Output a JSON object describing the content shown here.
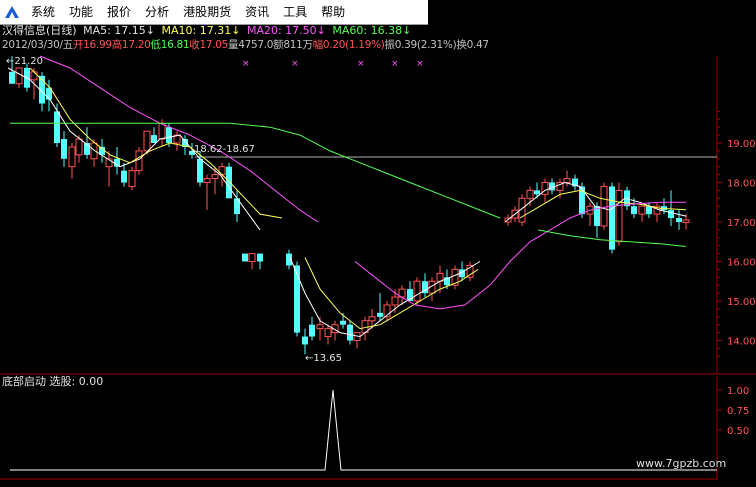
{
  "menu": {
    "items": [
      "系统",
      "功能",
      "报价",
      "分析",
      "港股期货",
      "资讯",
      "工具",
      "帮助"
    ]
  },
  "stock_header": {
    "name": "汉得信息(日线)",
    "ma5": "MA5: 17.15↓",
    "ma10": "MA10: 17.31↓",
    "ma20": "MA20: 17.50↓",
    "ma60": "MA60: 16.38↓",
    "date": "2012/03/30/五",
    "open": "开16.99",
    "high": "高17.20",
    "low": "低16.81",
    "close": "收17.05",
    "volume": "量4757.0",
    "amount": "额811万",
    "change": "幅0.20(1.19%)",
    "amplitude": "振0.39(2.31%)",
    "turnover": "换0.47"
  },
  "annotations": {
    "high_label": "21.20",
    "mid_label": "18.62-18.67",
    "low_label": "13.65"
  },
  "price_axis": {
    "ticks": [
      "19.00",
      "18.00",
      "17.00",
      "16.00",
      "15.00",
      "14.00"
    ]
  },
  "indicator": {
    "title": "底部启动",
    "value_label": "选股: 0.00",
    "ticks": [
      "1.00",
      "0.75",
      "0.50"
    ]
  },
  "watermark": "www.7gpzb.com",
  "colors": {
    "ma5": "#ffffff",
    "ma10": "#ffff54",
    "ma20": "#ff54ff",
    "ma60": "#54ff54",
    "up": "#ff5454",
    "down": "#54ffff",
    "axis": "#a00000"
  }
}
